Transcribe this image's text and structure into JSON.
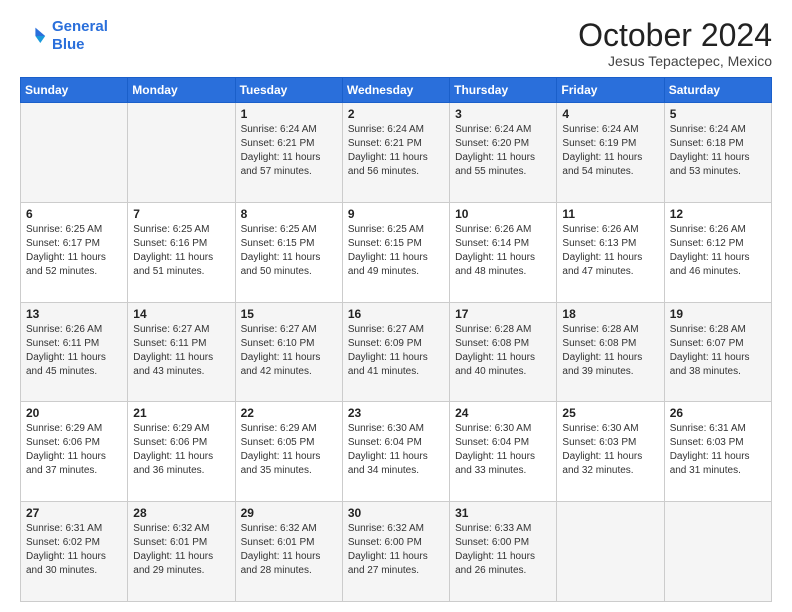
{
  "logo": {
    "line1": "General",
    "line2": "Blue"
  },
  "title": "October 2024",
  "subtitle": "Jesus Tepactepec, Mexico",
  "header_days": [
    "Sunday",
    "Monday",
    "Tuesday",
    "Wednesday",
    "Thursday",
    "Friday",
    "Saturday"
  ],
  "weeks": [
    [
      {
        "day": "",
        "info": ""
      },
      {
        "day": "",
        "info": ""
      },
      {
        "day": "1",
        "info": "Sunrise: 6:24 AM\nSunset: 6:21 PM\nDaylight: 11 hours and 57 minutes."
      },
      {
        "day": "2",
        "info": "Sunrise: 6:24 AM\nSunset: 6:21 PM\nDaylight: 11 hours and 56 minutes."
      },
      {
        "day": "3",
        "info": "Sunrise: 6:24 AM\nSunset: 6:20 PM\nDaylight: 11 hours and 55 minutes."
      },
      {
        "day": "4",
        "info": "Sunrise: 6:24 AM\nSunset: 6:19 PM\nDaylight: 11 hours and 54 minutes."
      },
      {
        "day": "5",
        "info": "Sunrise: 6:24 AM\nSunset: 6:18 PM\nDaylight: 11 hours and 53 minutes."
      }
    ],
    [
      {
        "day": "6",
        "info": "Sunrise: 6:25 AM\nSunset: 6:17 PM\nDaylight: 11 hours and 52 minutes."
      },
      {
        "day": "7",
        "info": "Sunrise: 6:25 AM\nSunset: 6:16 PM\nDaylight: 11 hours and 51 minutes."
      },
      {
        "day": "8",
        "info": "Sunrise: 6:25 AM\nSunset: 6:15 PM\nDaylight: 11 hours and 50 minutes."
      },
      {
        "day": "9",
        "info": "Sunrise: 6:25 AM\nSunset: 6:15 PM\nDaylight: 11 hours and 49 minutes."
      },
      {
        "day": "10",
        "info": "Sunrise: 6:26 AM\nSunset: 6:14 PM\nDaylight: 11 hours and 48 minutes."
      },
      {
        "day": "11",
        "info": "Sunrise: 6:26 AM\nSunset: 6:13 PM\nDaylight: 11 hours and 47 minutes."
      },
      {
        "day": "12",
        "info": "Sunrise: 6:26 AM\nSunset: 6:12 PM\nDaylight: 11 hours and 46 minutes."
      }
    ],
    [
      {
        "day": "13",
        "info": "Sunrise: 6:26 AM\nSunset: 6:11 PM\nDaylight: 11 hours and 45 minutes."
      },
      {
        "day": "14",
        "info": "Sunrise: 6:27 AM\nSunset: 6:11 PM\nDaylight: 11 hours and 43 minutes."
      },
      {
        "day": "15",
        "info": "Sunrise: 6:27 AM\nSunset: 6:10 PM\nDaylight: 11 hours and 42 minutes."
      },
      {
        "day": "16",
        "info": "Sunrise: 6:27 AM\nSunset: 6:09 PM\nDaylight: 11 hours and 41 minutes."
      },
      {
        "day": "17",
        "info": "Sunrise: 6:28 AM\nSunset: 6:08 PM\nDaylight: 11 hours and 40 minutes."
      },
      {
        "day": "18",
        "info": "Sunrise: 6:28 AM\nSunset: 6:08 PM\nDaylight: 11 hours and 39 minutes."
      },
      {
        "day": "19",
        "info": "Sunrise: 6:28 AM\nSunset: 6:07 PM\nDaylight: 11 hours and 38 minutes."
      }
    ],
    [
      {
        "day": "20",
        "info": "Sunrise: 6:29 AM\nSunset: 6:06 PM\nDaylight: 11 hours and 37 minutes."
      },
      {
        "day": "21",
        "info": "Sunrise: 6:29 AM\nSunset: 6:06 PM\nDaylight: 11 hours and 36 minutes."
      },
      {
        "day": "22",
        "info": "Sunrise: 6:29 AM\nSunset: 6:05 PM\nDaylight: 11 hours and 35 minutes."
      },
      {
        "day": "23",
        "info": "Sunrise: 6:30 AM\nSunset: 6:04 PM\nDaylight: 11 hours and 34 minutes."
      },
      {
        "day": "24",
        "info": "Sunrise: 6:30 AM\nSunset: 6:04 PM\nDaylight: 11 hours and 33 minutes."
      },
      {
        "day": "25",
        "info": "Sunrise: 6:30 AM\nSunset: 6:03 PM\nDaylight: 11 hours and 32 minutes."
      },
      {
        "day": "26",
        "info": "Sunrise: 6:31 AM\nSunset: 6:03 PM\nDaylight: 11 hours and 31 minutes."
      }
    ],
    [
      {
        "day": "27",
        "info": "Sunrise: 6:31 AM\nSunset: 6:02 PM\nDaylight: 11 hours and 30 minutes."
      },
      {
        "day": "28",
        "info": "Sunrise: 6:32 AM\nSunset: 6:01 PM\nDaylight: 11 hours and 29 minutes."
      },
      {
        "day": "29",
        "info": "Sunrise: 6:32 AM\nSunset: 6:01 PM\nDaylight: 11 hours and 28 minutes."
      },
      {
        "day": "30",
        "info": "Sunrise: 6:32 AM\nSunset: 6:00 PM\nDaylight: 11 hours and 27 minutes."
      },
      {
        "day": "31",
        "info": "Sunrise: 6:33 AM\nSunset: 6:00 PM\nDaylight: 11 hours and 26 minutes."
      },
      {
        "day": "",
        "info": ""
      },
      {
        "day": "",
        "info": ""
      }
    ]
  ]
}
